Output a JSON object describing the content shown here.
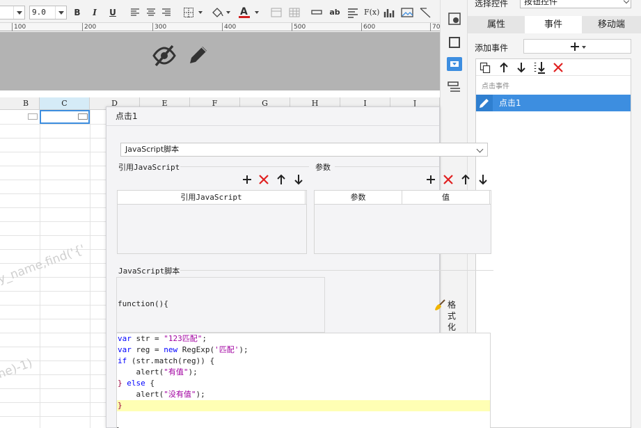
{
  "toolbar": {
    "font_size": "9.0",
    "bold_label": "B",
    "italic_label": "I",
    "underline_label": "U",
    "text_tool_label": "ab",
    "formula_label": "F(x)",
    "text_color": "#d02020"
  },
  "ruler": {
    "ticks": [
      "100",
      "200",
      "300",
      "400",
      "500",
      "600",
      "700"
    ]
  },
  "sheet": {
    "columns": [
      "B",
      "C",
      "D",
      "E",
      "F",
      "G",
      "H",
      "I",
      "J"
    ],
    "selected_column": "C",
    "watermark_1": "y_name,find('{'",
    "watermark_2": "ne)-1)"
  },
  "dialog": {
    "title": "点击1",
    "script_type": "JavaScript脚本",
    "ref_section_label": "引用JavaScript",
    "params_section_label": "参数",
    "ref_table_header": "引用JavaScript",
    "params_col_param": "参数",
    "params_col_value": "值",
    "script_section_label": "JavaScript脚本",
    "function_header": "function(){",
    "format_code_label": "格式化代码",
    "code": {
      "l1_kw": "var",
      "l1_mid": " str = ",
      "l1_str": "\"123匹配\"",
      "l1_end": ";",
      "l2_kw": "var",
      "l2_mid": " reg = ",
      "l2_kw2": "new",
      "l2_mid2": " RegExp(",
      "l2_str": "'匹配'",
      "l2_end": ");",
      "l3_kw": "if",
      "l3_rest": " (str.match(reg)) {",
      "l4_pre": "    alert(",
      "l4_str": "\"有值\"",
      "l4_end": ");",
      "l5_a": "} ",
      "l5_kw": "else",
      "l5_b": " {",
      "l6_pre": "    alert(",
      "l6_str": "\"没有值\"",
      "l6_end": ");",
      "l7": "}"
    },
    "closing_brace": "}"
  },
  "panel": {
    "select_label": "选择控件",
    "select_value": "按钮控件",
    "tabs": [
      "属性",
      "事件",
      "移动端"
    ],
    "active_tab": "事件",
    "add_event_label": "添加事件",
    "event_group_label": "点击事件",
    "event_item": "点击1"
  },
  "colors": {
    "accent": "#3d8ee0",
    "delete_red": "#e02020",
    "code_highlight": "#ffffb4"
  }
}
